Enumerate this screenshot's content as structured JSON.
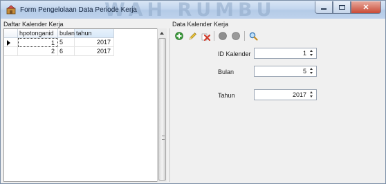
{
  "window": {
    "title": "Form Pengelolaan Data Periode Kerja",
    "watermark": "WAH RUMBU",
    "controls": {
      "minimize": "minimize-icon",
      "maximize": "maximize-icon",
      "close": "✕"
    }
  },
  "list_panel": {
    "label": "Daftar Kalender Kerja",
    "columns": [
      "hpotonganid",
      "bulan",
      "tahun"
    ],
    "rows": [
      {
        "id": "1",
        "bulan": "5",
        "tahun": "2017"
      },
      {
        "id": "2",
        "bulan": "6",
        "tahun": "2017"
      }
    ]
  },
  "detail_panel": {
    "label": "Data Kalender Kerja",
    "toolbar": [
      "add-icon",
      "edit-icon",
      "delete-icon",
      "save-icon",
      "cancel-icon",
      "search-icon"
    ],
    "fields": {
      "id_kalender": {
        "label": "ID Kalender",
        "value": "1"
      },
      "bulan": {
        "label": "Bulan",
        "value": "5"
      },
      "tahun": {
        "label": "Tahun",
        "value": "2017"
      }
    }
  },
  "colors": {
    "accent": "#2f8d2f",
    "titlebar": "#c3d6ee",
    "close": "#c94a36"
  }
}
